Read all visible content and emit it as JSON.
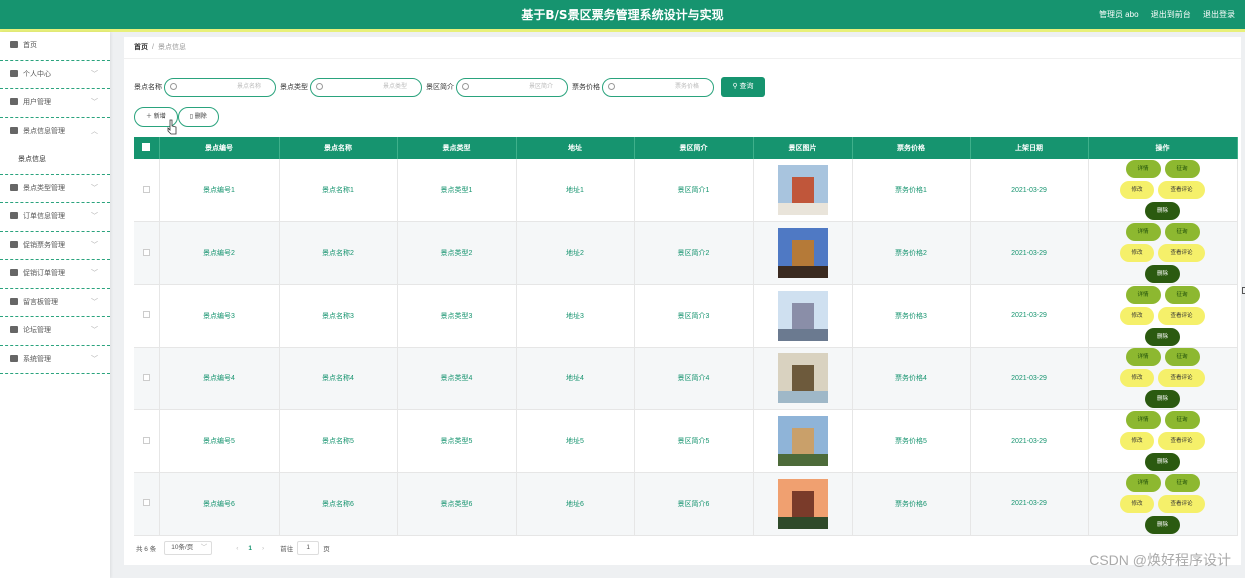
{
  "header": {
    "title": "基于B/S景区票务管理系统设计与实现",
    "admin_label": "管理员 abo",
    "backend_link": "退出到前台",
    "logout_link": "退出登录"
  },
  "sidebar": {
    "items": [
      {
        "label": "首页",
        "icon": "home-icon"
      },
      {
        "label": "个人中心",
        "icon": "user-icon"
      },
      {
        "label": "用户管理",
        "icon": "list-icon"
      },
      {
        "label": "景点信息管理",
        "icon": "scenic-icon"
      },
      {
        "label": "景点信息",
        "icon": ""
      },
      {
        "label": "景点类型管理",
        "icon": "list-icon"
      },
      {
        "label": "订单信息管理",
        "icon": "order-icon"
      },
      {
        "label": "促销票务管理",
        "icon": "ticket-icon"
      },
      {
        "label": "促销订单管理",
        "icon": "flag-icon"
      },
      {
        "label": "留言板管理",
        "icon": "message-icon"
      },
      {
        "label": "论坛管理",
        "icon": "forum-icon"
      },
      {
        "label": "系统管理",
        "icon": "settings-icon"
      }
    ]
  },
  "breadcrumb": {
    "home": "首页",
    "separator": "/",
    "current": "景点信息"
  },
  "search": {
    "fields": [
      {
        "label": "景点名称",
        "placeholder": "景点名称"
      },
      {
        "label": "景点类型",
        "placeholder": "景点类型"
      },
      {
        "label": "景区简介",
        "placeholder": "景区简介"
      },
      {
        "label": "票务价格",
        "placeholder": "票务价格"
      }
    ],
    "query_button": "查询"
  },
  "toolbar": {
    "add_label": "新增",
    "delete_label": "删除"
  },
  "table": {
    "columns": [
      "景点编号",
      "景点名称",
      "景点类型",
      "地址",
      "景区简介",
      "景区图片",
      "票务价格",
      "上架日期",
      "操作"
    ],
    "rows": [
      {
        "code": "景点编号1",
        "name": "景点名称1",
        "type": "景点类型1",
        "address": "地址1",
        "intro": "景区简介1",
        "price": "票务价格1",
        "date": "2021-03-29"
      },
      {
        "code": "景点编号2",
        "name": "景点名称2",
        "type": "景点类型2",
        "address": "地址2",
        "intro": "景区简介2",
        "price": "票务价格2",
        "date": "2021-03-29"
      },
      {
        "code": "景点编号3",
        "name": "景点名称3",
        "type": "景点类型3",
        "address": "地址3",
        "intro": "景区简介3",
        "price": "票务价格3",
        "date": "2021-03-29"
      },
      {
        "code": "景点编号4",
        "name": "景点名称4",
        "type": "景点类型4",
        "address": "地址4",
        "intro": "景区简介4",
        "price": "票务价格4",
        "date": "2021-03-29"
      },
      {
        "code": "景点编号5",
        "name": "景点名称5",
        "type": "景点类型5",
        "address": "地址5",
        "intro": "景区简介5",
        "price": "票务价格5",
        "date": "2021-03-29"
      },
      {
        "code": "景点编号6",
        "name": "景点名称6",
        "type": "景点类型6",
        "address": "地址6",
        "intro": "景区简介6",
        "price": "票务价格6",
        "date": "2021-03-29"
      }
    ],
    "row_actions": {
      "detail": "详情",
      "comment": "征询",
      "edit": "修改",
      "review": "查看评论",
      "delete": "删除"
    }
  },
  "pagination": {
    "total": "共 6 条",
    "page_size": "10条/页",
    "current_page": "1",
    "goto_label": "前往",
    "goto_value": "1",
    "page_suffix": "页"
  },
  "watermark": "CSDN @焕好程序设计",
  "colors": {
    "primary": "#16946f",
    "accent_bar": "#e8f07a",
    "btn_green": "#8db830",
    "btn_yellow": "#f5f06a",
    "btn_dark": "#2b5a10"
  }
}
